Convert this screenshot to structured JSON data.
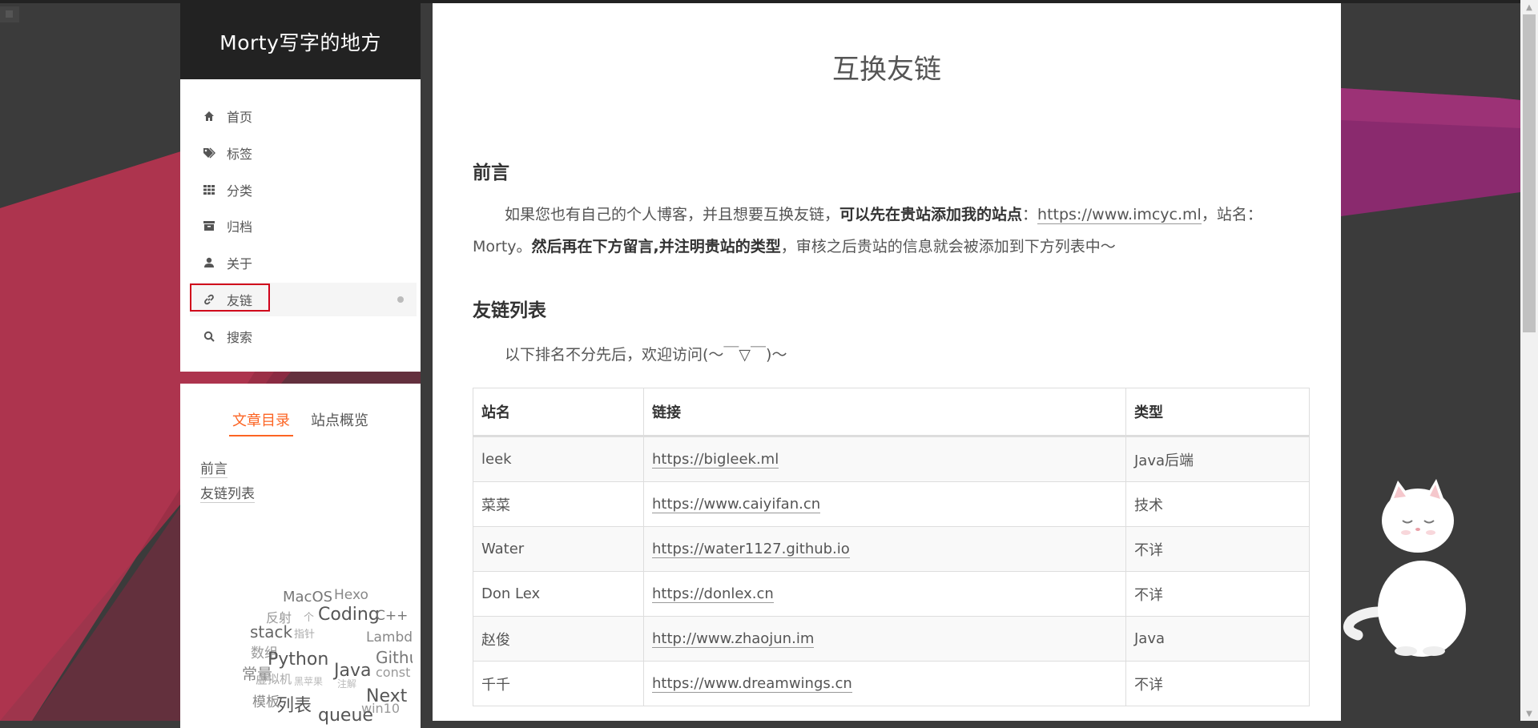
{
  "brand": {
    "title": "Morty写字的地方"
  },
  "menu": {
    "items": [
      {
        "label": "首页",
        "icon": "home-icon"
      },
      {
        "label": "标签",
        "icon": "tags-icon"
      },
      {
        "label": "分类",
        "icon": "grid-icon"
      },
      {
        "label": "归档",
        "icon": "archive-icon"
      },
      {
        "label": "关于",
        "icon": "user-icon"
      },
      {
        "label": "友链",
        "icon": "link-icon",
        "active": true
      },
      {
        "label": "搜索",
        "icon": "search-icon"
      }
    ]
  },
  "toc": {
    "tabs": {
      "toc": "文章目录",
      "overview": "站点概览"
    },
    "items": [
      "前言",
      "友链列表"
    ]
  },
  "tag_cloud": [
    "MacOS",
    "Hexo",
    "反射",
    "个",
    "Coding",
    "C++",
    "stack",
    "指针",
    "数组",
    "Lambda",
    "Python",
    "Github",
    "常量",
    "Java",
    "const",
    "虚拟机",
    "黑苹果",
    "注解",
    "模板",
    "列表",
    "Next",
    "win10",
    "queue"
  ],
  "post": {
    "title": "互换友链",
    "section1": "前言",
    "intro_1": "如果您也有自己的个人博客，并且想要互换友链，",
    "intro_bold_1": "可以先在贵站添加我的站点",
    "intro_2": "：",
    "intro_link": "https://www.imcyc.ml",
    "intro_3": "，站名：Morty。",
    "intro_bold_2": "然后再在下方留言,并注明贵站的类型",
    "intro_4": "，审核之后贵站的信息就会被添加到下方列表中～",
    "section2": "友链列表",
    "list_intro": "以下排名不分先后，欢迎访问(～￣▽￣)～",
    "table": {
      "headers": [
        "站名",
        "链接",
        "类型"
      ],
      "rows": [
        {
          "name": "leek",
          "link": "https://bigleek.ml",
          "type": "Java后端"
        },
        {
          "name": "菜菜",
          "link": "https://www.caiyifan.cn",
          "type": "技术"
        },
        {
          "name": "Water",
          "link": "https://water1127.github.io",
          "type": "不详"
        },
        {
          "name": "Don Lex",
          "link": "https://donlex.cn",
          "type": "不详"
        },
        {
          "name": "赵俊",
          "link": "http://www.zhaojun.im",
          "type": "Java"
        },
        {
          "name": "千千",
          "link": "https://www.dreamwings.cn",
          "type": "不详"
        }
      ]
    }
  },
  "colors": {
    "accent": "#fc6423",
    "sidebar_header": "#222222",
    "highlight_border": "#d0021b"
  }
}
